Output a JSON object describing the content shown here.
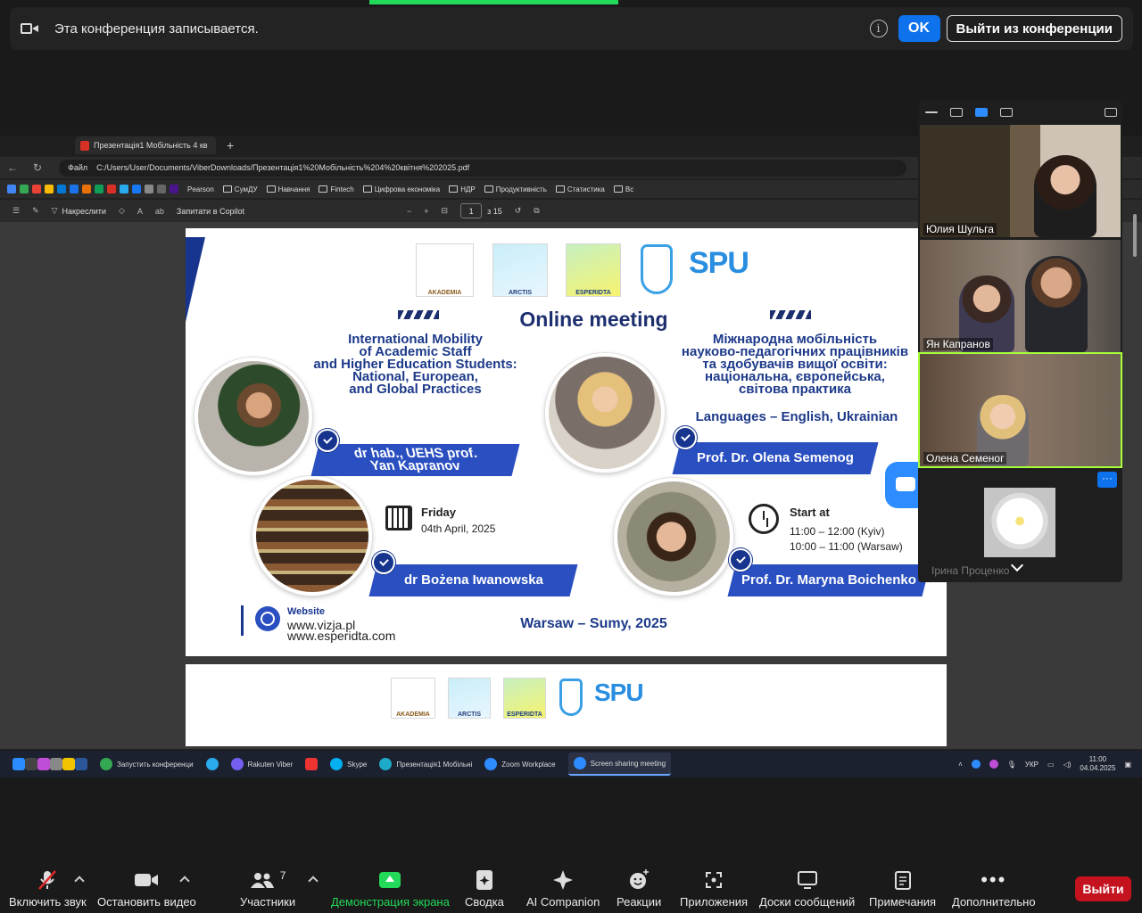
{
  "recording_bar": {
    "message": "Эта конференция записывается.",
    "ok_label": "OK",
    "leave_label": "Выйти из конференции"
  },
  "browser": {
    "tab_title": "Презентація1 Мобільність 4 кв",
    "file_label": "Файл",
    "url": "C:/Users/User/Documents/ViberDownloads/Презентація1%20Мобільність%204%20квітня%202025.pdf",
    "bookmarks": [
      "Pearson",
      "СумДУ",
      "Навчання",
      "Fintech",
      "Цифрова економіка",
      "НДР",
      "Продуктивність",
      "Статистика",
      "Вс"
    ],
    "toolbar": {
      "draw_label": "Накреслити",
      "copilot_label": "Запитати в Copilot",
      "page_current": "1",
      "page_total": "з 15"
    }
  },
  "slide": {
    "title": "Online meeting",
    "left_title": [
      "International Mobility",
      "of Academic Staff",
      "and Higher Education Students:",
      "National, European,",
      "and Global Practices"
    ],
    "right_title": [
      "Міжнародна мобільність",
      "науково-педагогічних працівників",
      "та здобувачів вищої освіти:",
      "національна, європейська,",
      "світова практика"
    ],
    "languages": "Languages – English, Ukrainian",
    "speaker1": [
      "dr hab., UEHS prof.",
      "Yan Kapranov"
    ],
    "speaker2": "Prof. Dr. Olena Semenog",
    "speaker3": "dr Bożena Iwanowska",
    "speaker4": "Prof. Dr. Maryna Boichenko",
    "date_day": "Friday",
    "date_full": "04th April, 2025",
    "start_label": "Start at",
    "time_kyiv": "11:00 – 12:00 (Kyiv)",
    "time_warsaw": "10:00 – 11:00 (Warsaw)",
    "website_label": "Website",
    "website1": "www.vizja.pl",
    "website2": "www.esperidta.com",
    "place": "Warsaw – Sumy, 2025",
    "logos": {
      "akademia": "AKADEMIA",
      "arctis": "ARCTIS",
      "esperidta": "ESPERIDTA",
      "spu": "SPU"
    }
  },
  "gallery": {
    "participants": [
      {
        "name": "Юлия Шульга"
      },
      {
        "name": "Ян Капранов"
      },
      {
        "name": "Олена Семеног"
      },
      {
        "name": "Ірина Проценко"
      }
    ],
    "more_label": "···"
  },
  "taskbar": {
    "items": [
      "Запустить конференци",
      "Rakuten Viber",
      "Skype",
      "Презентація1 Мобільні",
      "Zoom Workplace",
      "Screen sharing meeting"
    ],
    "lang": "УКР",
    "time": "11:00",
    "date": "04.04.2025"
  },
  "controls": {
    "mute": "Включить звук",
    "video": "Остановить видео",
    "participants": "Участники",
    "participants_count": "7",
    "share": "Демонстрация экрана",
    "summary": "Сводка",
    "ai": "AI Companion",
    "reactions": "Реакции",
    "apps": "Приложения",
    "whiteboards": "Доски сообщений",
    "notes": "Примечания",
    "more": "Дополнительно",
    "leave": "Выйти"
  },
  "colors": {
    "accent_blue": "#0e72ed",
    "share_green": "#23d959",
    "leave_red": "#c4121e",
    "slide_navy": "#17358f"
  }
}
